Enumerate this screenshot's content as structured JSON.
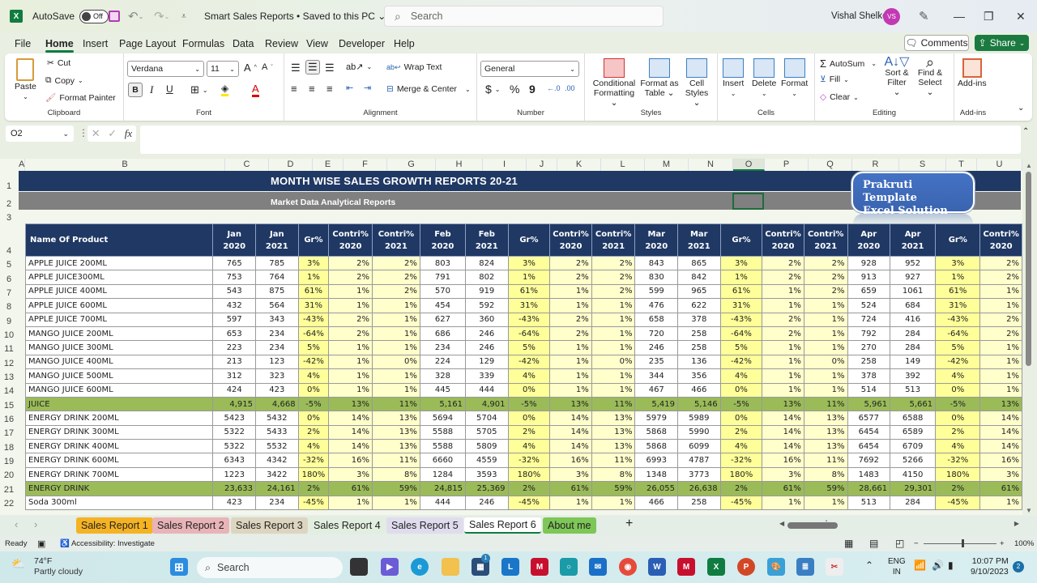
{
  "titlebar": {
    "app_icon": "excel-icon",
    "autosave_label": "AutoSave",
    "autosave_state": "Off",
    "doc_title": "Smart Sales Reports • Saved to this PC ⌄",
    "search_placeholder": "Search",
    "user_name": "Vishal Shelke",
    "user_initials": "VS",
    "minimize": "—",
    "restore": "❐",
    "close": "✕"
  },
  "menu": {
    "items": [
      "File",
      "Home",
      "Insert",
      "Page Layout",
      "Formulas",
      "Data",
      "Review",
      "View",
      "Developer",
      "Help"
    ],
    "active": "Home",
    "comments_label": "Comments",
    "share_label": "Share"
  },
  "ribbon": {
    "clipboard": {
      "paste": "Paste",
      "cut": "Cut",
      "copy": "Copy",
      "format_painter": "Format Painter",
      "label": "Clipboard"
    },
    "font": {
      "family": "Verdana",
      "size": "11",
      "label": "Font",
      "bold": "B",
      "italic": "I",
      "underline": "U"
    },
    "alignment": {
      "wrap_text": "Wrap Text",
      "merge_center": "Merge & Center",
      "label": "Alignment"
    },
    "number": {
      "format": "General",
      "currency": "$",
      "percent": "%",
      "comma": "9",
      "label": "Number"
    },
    "styles": {
      "conditional": "Conditional Formatting ⌄",
      "format_table": "Format as Table ⌄",
      "cell_styles": "Cell Styles ⌄",
      "label": "Styles"
    },
    "cells": {
      "insert": "Insert",
      "delete": "Delete",
      "format": "Format",
      "label": "Cells"
    },
    "editing": {
      "autosum": "AutoSum",
      "fill": "Fill",
      "clear": "Clear",
      "sort_filter": "Sort & Filter ⌄",
      "find_select": "Find & Select ⌄",
      "label": "Editing"
    },
    "addins": {
      "addins": "Add-ins",
      "label": "Add-ins"
    }
  },
  "formula_bar": {
    "name_box": "O2",
    "fx": "fx",
    "formula": ""
  },
  "columns": [
    "A",
    "B",
    "C",
    "D",
    "E",
    "F",
    "G",
    "H",
    "I",
    "J",
    "K",
    "L",
    "M",
    "N",
    "O",
    "P",
    "Q",
    "R",
    "S",
    "T",
    "U"
  ],
  "selected_column": "O",
  "rows": [
    "1",
    "2",
    "3",
    "4",
    "5",
    "6",
    "7",
    "8",
    "9",
    "10",
    "11",
    "12",
    "13",
    "14",
    "15",
    "16",
    "17",
    "18",
    "19",
    "20",
    "21",
    "22"
  ],
  "sheet": {
    "title": "MONTH WISE SALES GROWTH REPORTS 20-21",
    "subtitle": "Market Data Analytical Reports",
    "badge_line1": "Prakruti Template",
    "badge_line2": "Excel Solution",
    "headers": [
      [
        "Name Of Product"
      ],
      [
        "Jan",
        "2020"
      ],
      [
        "Jan",
        "2021"
      ],
      [
        "Gr%"
      ],
      [
        "Contri%",
        "2020"
      ],
      [
        "Contri%",
        "2021"
      ],
      [
        "Feb",
        "2020"
      ],
      [
        "Feb",
        "2021"
      ],
      [
        "Gr%"
      ],
      [
        "Contri%",
        "2020"
      ],
      [
        "Contri%",
        "2021"
      ],
      [
        "Mar",
        "2020"
      ],
      [
        "Mar",
        "2021"
      ],
      [
        "Gr%"
      ],
      [
        "Contri%",
        "2020"
      ],
      [
        "Contri%",
        "2021"
      ],
      [
        "Apr",
        "2020"
      ],
      [
        "Apr",
        "2021"
      ],
      [
        "Gr%"
      ],
      [
        "Contri%",
        "2020"
      ]
    ],
    "data_rows": [
      {
        "type": "item",
        "cells": [
          "APPLE JUICE 200ML",
          "765",
          "785",
          "3%",
          "2%",
          "2%",
          "803",
          "824",
          "3%",
          "2%",
          "2%",
          "843",
          "865",
          "3%",
          "2%",
          "2%",
          "928",
          "952",
          "3%",
          "2%"
        ]
      },
      {
        "type": "item",
        "cells": [
          "APPLE JUICE300ML",
          "753",
          "764",
          "1%",
          "2%",
          "2%",
          "791",
          "802",
          "1%",
          "2%",
          "2%",
          "830",
          "842",
          "1%",
          "2%",
          "2%",
          "913",
          "927",
          "1%",
          "2%"
        ]
      },
      {
        "type": "item",
        "cells": [
          "APPLE JUICE 400ML",
          "543",
          "875",
          "61%",
          "1%",
          "2%",
          "570",
          "919",
          "61%",
          "1%",
          "2%",
          "599",
          "965",
          "61%",
          "1%",
          "2%",
          "659",
          "1061",
          "61%",
          "1%"
        ]
      },
      {
        "type": "item",
        "cells": [
          "APPLE JUICE 600ML",
          "432",
          "564",
          "31%",
          "1%",
          "1%",
          "454",
          "592",
          "31%",
          "1%",
          "1%",
          "476",
          "622",
          "31%",
          "1%",
          "1%",
          "524",
          "684",
          "31%",
          "1%"
        ]
      },
      {
        "type": "item",
        "cells": [
          "APPLE JUICE 700ML",
          "597",
          "343",
          "-43%",
          "2%",
          "1%",
          "627",
          "360",
          "-43%",
          "2%",
          "1%",
          "658",
          "378",
          "-43%",
          "2%",
          "1%",
          "724",
          "416",
          "-43%",
          "2%"
        ]
      },
      {
        "type": "item",
        "cells": [
          "MANGO JUICE  200ML",
          "653",
          "234",
          "-64%",
          "2%",
          "1%",
          "686",
          "246",
          "-64%",
          "2%",
          "1%",
          "720",
          "258",
          "-64%",
          "2%",
          "1%",
          "792",
          "284",
          "-64%",
          "2%"
        ]
      },
      {
        "type": "item",
        "cells": [
          "MANGO JUICE 300ML",
          "223",
          "234",
          "5%",
          "1%",
          "1%",
          "234",
          "246",
          "5%",
          "1%",
          "1%",
          "246",
          "258",
          "5%",
          "1%",
          "1%",
          "270",
          "284",
          "5%",
          "1%"
        ]
      },
      {
        "type": "item",
        "cells": [
          "MANGO JUICE 400ML",
          "213",
          "123",
          "-42%",
          "1%",
          "0%",
          "224",
          "129",
          "-42%",
          "1%",
          "0%",
          "235",
          "136",
          "-42%",
          "1%",
          "0%",
          "258",
          "149",
          "-42%",
          "1%"
        ]
      },
      {
        "type": "item",
        "cells": [
          "MANGO JUICE 500ML",
          "312",
          "323",
          "4%",
          "1%",
          "1%",
          "328",
          "339",
          "4%",
          "1%",
          "1%",
          "344",
          "356",
          "4%",
          "1%",
          "1%",
          "378",
          "392",
          "4%",
          "1%"
        ]
      },
      {
        "type": "item",
        "cells": [
          "MANGO JUICE 600ML",
          "424",
          "423",
          "0%",
          "1%",
          "1%",
          "445",
          "444",
          "0%",
          "1%",
          "1%",
          "467",
          "466",
          "0%",
          "1%",
          "1%",
          "514",
          "513",
          "0%",
          "1%"
        ]
      },
      {
        "type": "total",
        "cells": [
          "JUICE",
          "4,915",
          "4,668",
          "-5%",
          "13%",
          "11%",
          "5,161",
          "4,901",
          "-5%",
          "13%",
          "11%",
          "5,419",
          "5,146",
          "-5%",
          "13%",
          "11%",
          "5,961",
          "5,661",
          "-5%",
          "13%"
        ]
      },
      {
        "type": "item",
        "cells": [
          "ENERGY DRINK  200ML",
          "5423",
          "5432",
          "0%",
          "14%",
          "13%",
          "5694",
          "5704",
          "0%",
          "14%",
          "13%",
          "5979",
          "5989",
          "0%",
          "14%",
          "13%",
          "6577",
          "6588",
          "0%",
          "14%"
        ]
      },
      {
        "type": "item",
        "cells": [
          "ENERGY DRINK  300ML",
          "5322",
          "5433",
          "2%",
          "14%",
          "13%",
          "5588",
          "5705",
          "2%",
          "14%",
          "13%",
          "5868",
          "5990",
          "2%",
          "14%",
          "13%",
          "6454",
          "6589",
          "2%",
          "14%"
        ]
      },
      {
        "type": "item",
        "cells": [
          "ENERGY DRINK  400ML",
          "5322",
          "5532",
          "4%",
          "14%",
          "13%",
          "5588",
          "5809",
          "4%",
          "14%",
          "13%",
          "5868",
          "6099",
          "4%",
          "14%",
          "13%",
          "6454",
          "6709",
          "4%",
          "14%"
        ]
      },
      {
        "type": "item",
        "cells": [
          "ENERGY DRINK  600ML",
          "6343",
          "4342",
          "-32%",
          "16%",
          "11%",
          "6660",
          "4559",
          "-32%",
          "16%",
          "11%",
          "6993",
          "4787",
          "-32%",
          "16%",
          "11%",
          "7692",
          "5266",
          "-32%",
          "16%"
        ]
      },
      {
        "type": "item",
        "cells": [
          "ENERGY DRINK  700ML",
          "1223",
          "3422",
          "180%",
          "3%",
          "8%",
          "1284",
          "3593",
          "180%",
          "3%",
          "8%",
          "1348",
          "3773",
          "180%",
          "3%",
          "8%",
          "1483",
          "4150",
          "180%",
          "3%"
        ]
      },
      {
        "type": "total",
        "cells": [
          "ENERGY DRINK",
          "23,633",
          "24,161",
          "2%",
          "61%",
          "59%",
          "24,815",
          "25,369",
          "2%",
          "61%",
          "59%",
          "26,055",
          "26,638",
          "2%",
          "61%",
          "59%",
          "28,661",
          "29,301",
          "2%",
          "61%"
        ]
      },
      {
        "type": "item",
        "cells": [
          "Soda 300ml",
          "423",
          "234",
          "-45%",
          "1%",
          "1%",
          "444",
          "246",
          "-45%",
          "1%",
          "1%",
          "466",
          "258",
          "-45%",
          "1%",
          "1%",
          "513",
          "284",
          "-45%",
          "1%"
        ]
      }
    ]
  },
  "sheet_tabs": [
    {
      "label": "Sales Report 1",
      "color": "#f5b324",
      "active": false
    },
    {
      "label": "Sales Report 2",
      "color": "#e8b4b8",
      "active": false
    },
    {
      "label": "Sales Report 3",
      "color": "#ddd5bf",
      "active": false
    },
    {
      "label": "Sales Report 4",
      "color": "#e2efe0",
      "active": false
    },
    {
      "label": "Sales Report 5",
      "color": "#e0dcee",
      "active": false
    },
    {
      "label": "Sales Report 6",
      "color": "#ffffff",
      "active": true
    },
    {
      "label": "About me",
      "color": "#7dc657",
      "active": false
    }
  ],
  "add_sheet": "+",
  "status": {
    "ready": "Ready",
    "accessibility": "Accessibility: Investigate",
    "zoom": "100%"
  },
  "taskbar": {
    "weather_temp": "74°F",
    "weather_desc": "Partly cloudy",
    "search": "Search",
    "store_badge": "1",
    "lang1": "ENG",
    "lang2": "IN",
    "time": "10:07 PM",
    "date": "9/10/2023",
    "notif": "2"
  }
}
